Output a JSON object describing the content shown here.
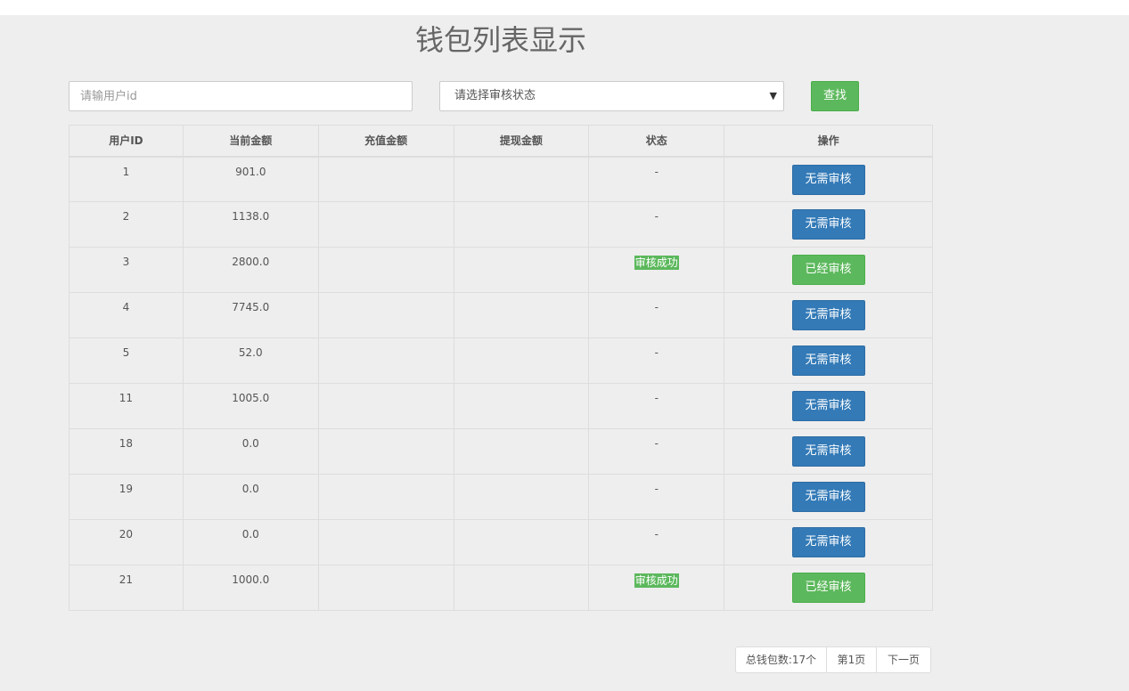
{
  "page": {
    "title": "钱包列表显示"
  },
  "filters": {
    "user_id_placeholder": "请输用户id",
    "status_select_value": "请选择审核状态",
    "find_button": "查找"
  },
  "table": {
    "headers": [
      "用户ID",
      "当前金额",
      "充值金额",
      "提现金额",
      "状态",
      "操作"
    ],
    "rows": [
      {
        "id": "1",
        "balance": "901.0",
        "recharge": "",
        "withdraw": "",
        "status": "-",
        "action": "无需审核",
        "action_type": "none"
      },
      {
        "id": "2",
        "balance": "1138.0",
        "recharge": "",
        "withdraw": "",
        "status": "-",
        "action": "无需审核",
        "action_type": "none"
      },
      {
        "id": "3",
        "balance": "2800.0",
        "recharge": "",
        "withdraw": "",
        "status": "审核成功",
        "action": "已经审核",
        "action_type": "done"
      },
      {
        "id": "4",
        "balance": "7745.0",
        "recharge": "",
        "withdraw": "",
        "status": "-",
        "action": "无需审核",
        "action_type": "none"
      },
      {
        "id": "5",
        "balance": "52.0",
        "recharge": "",
        "withdraw": "",
        "status": "-",
        "action": "无需审核",
        "action_type": "none"
      },
      {
        "id": "11",
        "balance": "1005.0",
        "recharge": "",
        "withdraw": "",
        "status": "-",
        "action": "无需审核",
        "action_type": "none"
      },
      {
        "id": "18",
        "balance": "0.0",
        "recharge": "",
        "withdraw": "",
        "status": "-",
        "action": "无需审核",
        "action_type": "none"
      },
      {
        "id": "19",
        "balance": "0.0",
        "recharge": "",
        "withdraw": "",
        "status": "-",
        "action": "无需审核",
        "action_type": "none"
      },
      {
        "id": "20",
        "balance": "0.0",
        "recharge": "",
        "withdraw": "",
        "status": "-",
        "action": "无需审核",
        "action_type": "none"
      },
      {
        "id": "21",
        "balance": "1000.0",
        "recharge": "",
        "withdraw": "",
        "status": "审核成功",
        "action": "已经审核",
        "action_type": "done"
      }
    ]
  },
  "pager": {
    "total": "总钱包数:17个",
    "current_page": "第1页",
    "next": "下一页"
  },
  "colors": {
    "primary_blue": "#337ab7",
    "success_green": "#5cb85c",
    "background": "#eeeeee"
  }
}
